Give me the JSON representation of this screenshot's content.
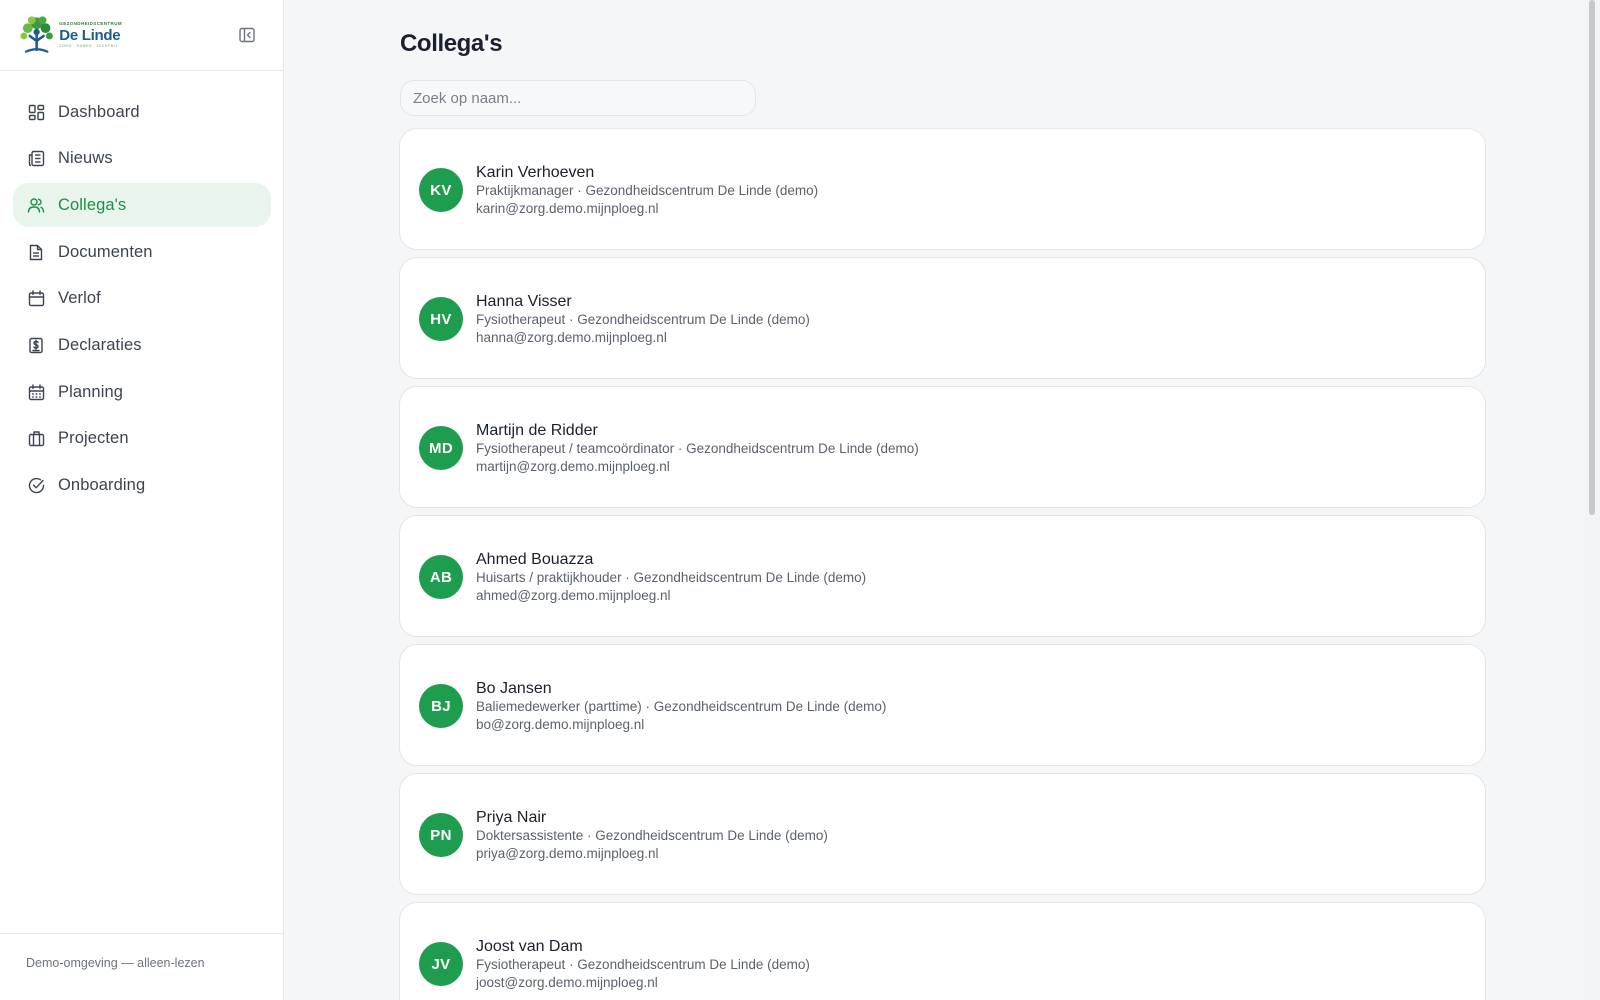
{
  "brand": {
    "sub": "GEZONDHEIDSCENTRUM",
    "name": "De Linde",
    "tagline": "ZORG · SAMEN · DICHTBIJ",
    "accent": "#1f9d4f",
    "active_bg": "#e8f4ec"
  },
  "sidebar": {
    "collapse_icon": "sidebar-collapse-icon",
    "items": [
      {
        "label": "Dashboard",
        "icon": "dashboard-icon"
      },
      {
        "label": "Nieuws",
        "icon": "news-icon"
      },
      {
        "label": "Collega's",
        "icon": "users-icon",
        "active": true
      },
      {
        "label": "Documenten",
        "icon": "document-icon"
      },
      {
        "label": "Verlof",
        "icon": "calendar-icon"
      },
      {
        "label": "Declaraties",
        "icon": "receipt-icon"
      },
      {
        "label": "Planning",
        "icon": "planning-icon"
      },
      {
        "label": "Projecten",
        "icon": "briefcase-icon"
      },
      {
        "label": "Onboarding",
        "icon": "check-circle-icon"
      }
    ],
    "footer": "Demo-omgeving — alleen-lezen"
  },
  "main": {
    "title": "Collega's",
    "search": {
      "placeholder": "Zoek op naam...",
      "value": ""
    },
    "colleagues": [
      {
        "initials": "KV",
        "name": "Karin Verhoeven",
        "role": "Praktijkmanager · Gezondheidscentrum De Linde (demo)",
        "email": "karin@zorg.demo.mijnploeg.nl"
      },
      {
        "initials": "HV",
        "name": "Hanna Visser",
        "role": "Fysiotherapeut · Gezondheidscentrum De Linde (demo)",
        "email": "hanna@zorg.demo.mijnploeg.nl"
      },
      {
        "initials": "MD",
        "name": "Martijn de Ridder",
        "role": "Fysiotherapeut / teamcoördinator · Gezondheidscentrum De Linde (demo)",
        "email": "martijn@zorg.demo.mijnploeg.nl"
      },
      {
        "initials": "AB",
        "name": "Ahmed Bouazza",
        "role": "Huisarts / praktijkhouder · Gezondheidscentrum De Linde (demo)",
        "email": "ahmed@zorg.demo.mijnploeg.nl"
      },
      {
        "initials": "BJ",
        "name": "Bo Jansen",
        "role": "Baliemedewerker (parttime) · Gezondheidscentrum De Linde (demo)",
        "email": "bo@zorg.demo.mijnploeg.nl"
      },
      {
        "initials": "PN",
        "name": "Priya Nair",
        "role": "Doktersassistente · Gezondheidscentrum De Linde (demo)",
        "email": "priya@zorg.demo.mijnploeg.nl"
      },
      {
        "initials": "JV",
        "name": "Joost van Dam",
        "role": "Fysiotherapeut · Gezondheidscentrum De Linde (demo)",
        "email": "joost@zorg.demo.mijnploeg.nl"
      }
    ]
  }
}
